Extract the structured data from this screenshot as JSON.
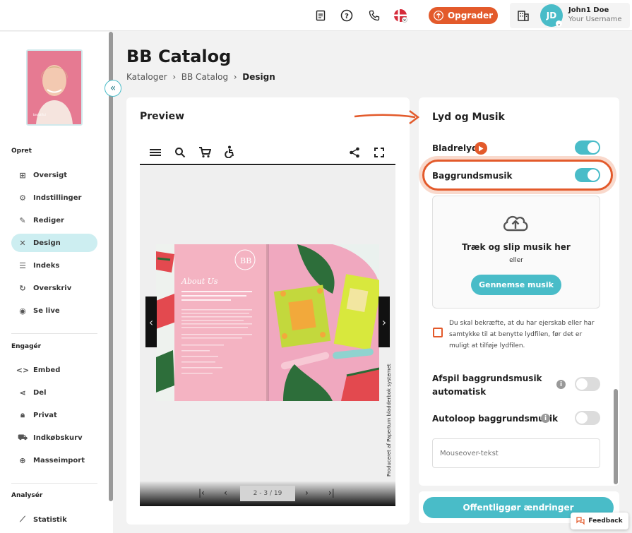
{
  "header": {
    "upgrade_label": "Opgrader",
    "avatar_initials": "JD",
    "user_name": "John1 Doe",
    "user_sub": "Your Username",
    "icons": [
      "document-icon",
      "help-icon",
      "phone-icon",
      "flag-icon",
      "building-icon"
    ]
  },
  "page": {
    "title": "BB Catalog",
    "breadcrumb": [
      "Kataloger",
      "BB Catalog",
      "Design"
    ]
  },
  "sidebar": {
    "sections": [
      {
        "title": "Opret",
        "items": [
          "Oversigt",
          "Indstillinger",
          "Rediger",
          "Design",
          "Indeks",
          "Overskriv",
          "Se live"
        ]
      },
      {
        "title": "Engagér",
        "items": [
          "Embed",
          "Del",
          "Privat",
          "Indkøbskurv",
          "Masseimport"
        ]
      },
      {
        "title": "Analysér",
        "items": [
          "Statistik"
        ]
      }
    ],
    "active_item": "Design"
  },
  "preview": {
    "title": "Preview",
    "page_indicator": "2 - 3 / 19",
    "produced_by": "Produceret af Paperturn bladderbok systemet",
    "about_title": "About Us",
    "about_text": "Our passion and mission is to create a plant-based skincare range with no additives or nasties and no fishy business."
  },
  "sound": {
    "title": "Lyd og Musik",
    "page_sound_label": "Bladrelyd",
    "page_sound_on": true,
    "bg_music_label": "Baggrundsmusik",
    "bg_music_on": true,
    "drop_title": "Træk og slip musik her",
    "drop_or": "eller",
    "browse_label": "Gennemse musik",
    "consent_text": "Du skal bekræfte, at du har ejerskab eller har samtykke til at benytte lydfilen, før det er muligt at tilføje lydfilen.",
    "autoplay_label_1": "Afspil baggrundsmusik",
    "autoplay_label_2": "automatisk",
    "autoplay_on": false,
    "autoloop_label": "Autoloop baggrundsmusik",
    "autoloop_on": false,
    "mouseover_placeholder": "Mouseover-tekst"
  },
  "footer": {
    "publish_label": "Offentliggør ændringer",
    "feedback_label": "Feedback"
  },
  "colors": {
    "accent": "#49bcc8",
    "brand_orange": "#e35a2b"
  }
}
